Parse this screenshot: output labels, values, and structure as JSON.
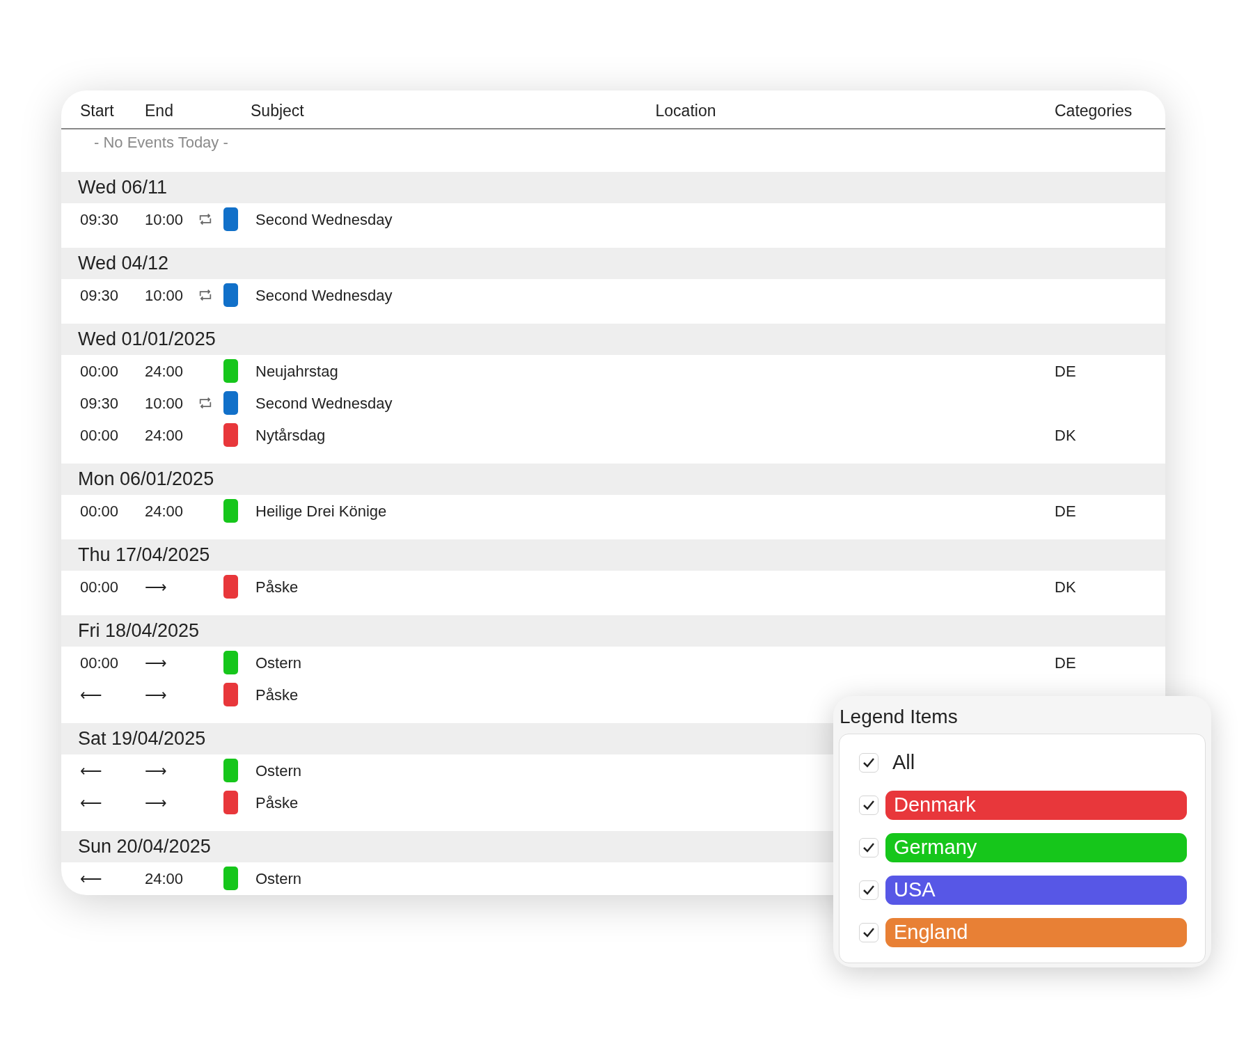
{
  "columns": [
    {
      "label": "Start"
    },
    {
      "label": "End"
    },
    {
      "label": "Subject"
    },
    {
      "label": "Location"
    },
    {
      "label": "Categories"
    }
  ],
  "empty_message": "- No Events Today -",
  "days": [
    {
      "date": "Wed 06/11",
      "events": [
        {
          "start": "09:30",
          "end": "10:00",
          "recurring": true,
          "color": "#1170c9",
          "subject": "Second Wednesday"
        }
      ]
    },
    {
      "date": "Wed 04/12",
      "events": [
        {
          "start": "09:30",
          "end": "10:00",
          "recurring": true,
          "color": "#1170c9",
          "subject": "Second Wednesday"
        }
      ]
    },
    {
      "date": "Wed 01/01/2025",
      "events": [
        {
          "start": "00:00",
          "end": "24:00",
          "recurring": false,
          "color": "#16c61b",
          "subject": "Neujahrstag",
          "category": "DE"
        },
        {
          "start": "09:30",
          "end": "10:00",
          "recurring": true,
          "color": "#1170c9",
          "subject": "Second Wednesday"
        },
        {
          "start": "00:00",
          "end": "24:00",
          "recurring": false,
          "color": "#e8373b",
          "subject": "Nytårsdag",
          "category": "DK"
        }
      ]
    },
    {
      "date": "Mon 06/01/2025",
      "events": [
        {
          "start": "00:00",
          "end": "24:00",
          "recurring": false,
          "color": "#16c61b",
          "subject": "Heilige Drei Könige",
          "category": "DE"
        }
      ]
    },
    {
      "date": "Thu 17/04/2025",
      "events": [
        {
          "start": "00:00",
          "end": "⟶",
          "recurring": false,
          "color": "#e8373b",
          "subject": "Påske",
          "category": "DK"
        }
      ]
    },
    {
      "date": "Fri 18/04/2025",
      "events": [
        {
          "start": "00:00",
          "end": "⟶",
          "recurring": false,
          "color": "#16c61b",
          "subject": "Ostern",
          "category": "DE"
        },
        {
          "start": "⟵",
          "end": "⟶",
          "recurring": false,
          "color": "#e8373b",
          "subject": "Påske"
        }
      ]
    },
    {
      "date": "Sat 19/04/2025",
      "events": [
        {
          "start": "⟵",
          "end": "⟶",
          "recurring": false,
          "color": "#16c61b",
          "subject": "Ostern"
        },
        {
          "start": "⟵",
          "end": "⟶",
          "recurring": false,
          "color": "#e8373b",
          "subject": "Påske"
        }
      ]
    },
    {
      "date": "Sun 20/04/2025",
      "events": [
        {
          "start": "⟵",
          "end": "24:00",
          "recurring": false,
          "color": "#16c61b",
          "subject": "Ostern"
        }
      ]
    }
  ],
  "legend": {
    "title": "Legend Items",
    "items": [
      {
        "kind": "all",
        "label": "All",
        "checked": true
      },
      {
        "kind": "category",
        "label": "Denmark",
        "color": "#e8373b",
        "checked": true
      },
      {
        "kind": "category",
        "label": "Germany",
        "color": "#16c61b",
        "checked": true
      },
      {
        "kind": "category",
        "label": "USA",
        "color": "#5757e6",
        "checked": true
      },
      {
        "kind": "category",
        "label": "England",
        "color": "#e88035",
        "checked": true
      }
    ]
  }
}
